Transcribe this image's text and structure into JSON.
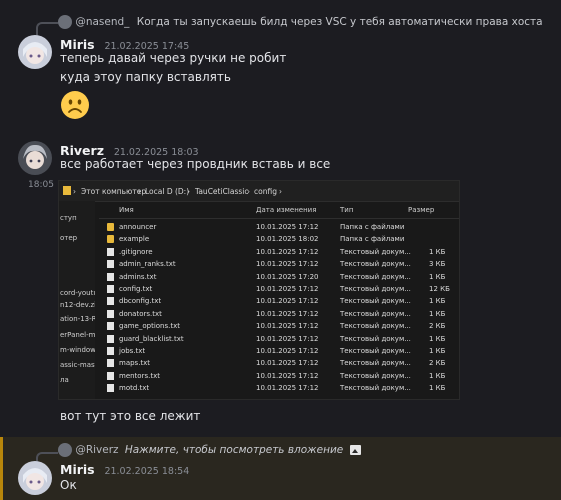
{
  "reply1": {
    "user": "@nasend_",
    "text": "Когда ты запускаешь билд через VSC у тебя автоматически права хоста"
  },
  "msg1": {
    "author": "Miris",
    "timestamp": "21.02.2025 17:45",
    "lines": [
      "теперь давай через ручки не робит",
      "куда этоу папку вставлять"
    ],
    "emoji": "frowning-face"
  },
  "msg2": {
    "author": "Riverz",
    "timestamp": "21.02.2025 18:03",
    "text": "все работает через провдник вставь и все",
    "side_time": "18:05",
    "after_text": "вот тут это все лежит"
  },
  "explorer": {
    "breadcrumb": [
      "Этот компьютер",
      "Local D (D:)",
      "TauCetiClassic",
      "config"
    ],
    "sidebar": [
      "ступ",
      "отер",
      "cord-youtu",
      "n12-dev.zip",
      "ation-13-R",
      "erPanel-m",
      "m-window",
      "assic-mast",
      "ла"
    ],
    "columns": [
      "Имя",
      "Дата изменения",
      "Тип",
      "Размер"
    ],
    "files": [
      {
        "name": "announcer",
        "date": "10.01.2025 17:12",
        "type": "Папка с файлами",
        "size": "",
        "folder": true
      },
      {
        "name": "example",
        "date": "10.01.2025 18:02",
        "type": "Папка с файлами",
        "size": "",
        "folder": true
      },
      {
        "name": ".gitignore",
        "date": "10.01.2025 17:12",
        "type": "Текстовый докум...",
        "size": "1 КБ",
        "folder": false
      },
      {
        "name": "admin_ranks.txt",
        "date": "10.01.2025 17:12",
        "type": "Текстовый докум...",
        "size": "3 КБ",
        "folder": false
      },
      {
        "name": "admins.txt",
        "date": "10.01.2025 17:20",
        "type": "Текстовый докум...",
        "size": "1 КБ",
        "folder": false
      },
      {
        "name": "config.txt",
        "date": "10.01.2025 17:12",
        "type": "Текстовый докум...",
        "size": "12 КБ",
        "folder": false
      },
      {
        "name": "dbconfig.txt",
        "date": "10.01.2025 17:12",
        "type": "Текстовый докум...",
        "size": "1 КБ",
        "folder": false
      },
      {
        "name": "donators.txt",
        "date": "10.01.2025 17:12",
        "type": "Текстовый докум...",
        "size": "1 КБ",
        "folder": false
      },
      {
        "name": "game_options.txt",
        "date": "10.01.2025 17:12",
        "type": "Текстовый докум...",
        "size": "2 КБ",
        "folder": false
      },
      {
        "name": "guard_blacklist.txt",
        "date": "10.01.2025 17:12",
        "type": "Текстовый докум...",
        "size": "1 КБ",
        "folder": false
      },
      {
        "name": "jobs.txt",
        "date": "10.01.2025 17:12",
        "type": "Текстовый докум...",
        "size": "1 КБ",
        "folder": false
      },
      {
        "name": "maps.txt",
        "date": "10.01.2025 17:12",
        "type": "Текстовый докум...",
        "size": "2 КБ",
        "folder": false
      },
      {
        "name": "mentors.txt",
        "date": "10.01.2025 17:12",
        "type": "Текстовый докум...",
        "size": "1 КБ",
        "folder": false
      },
      {
        "name": "motd.txt",
        "date": "10.01.2025 17:12",
        "type": "Текстовый докум...",
        "size": "1 КБ",
        "folder": false
      }
    ]
  },
  "reply2": {
    "user": "@Riverz",
    "text": "Нажмите, чтобы посмотреть вложение",
    "icon": "image-icon"
  },
  "msg3": {
    "author": "Miris",
    "timestamp": "21.02.2025 18:54",
    "text": "Ок"
  },
  "colors": {
    "background": "#1c1c21",
    "highlight": "#2a271f",
    "highlight_edge": "#b8860b",
    "folder": "#e8b93b"
  }
}
